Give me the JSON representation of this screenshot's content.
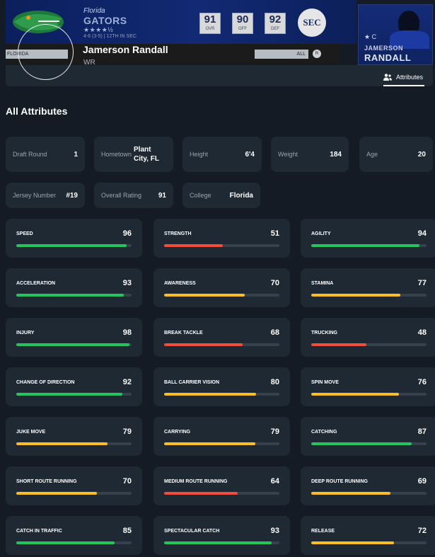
{
  "banner": {
    "school": "Florida",
    "team": "GATORS",
    "stars": "★★★★½",
    "record": "4-6 (3-5) | 12TH IN SEC",
    "ratings": [
      {
        "value": "91",
        "label": "OVR"
      },
      {
        "value": "90",
        "label": "OFF"
      },
      {
        "value": "92",
        "label": "DEF"
      }
    ],
    "conference": "SEC"
  },
  "subbar": {
    "school_tag": "FLORIDA",
    "filter": "ALL"
  },
  "player": {
    "name": "Jamerson Randall",
    "position": "WR",
    "card_first": "JAMERSON",
    "card_last": "RANDALL",
    "card_icons": "★ C"
  },
  "tabs": {
    "attributes": "Attributes"
  },
  "section_title": "All Attributes",
  "info": {
    "draft_round": {
      "label": "Draft Round",
      "value": "1"
    },
    "hometown": {
      "label": "Hometown",
      "value": "Plant City, FL"
    },
    "height": {
      "label": "Height",
      "value": "6'4"
    },
    "weight": {
      "label": "Weight",
      "value": "184"
    },
    "age": {
      "label": "Age",
      "value": "20"
    },
    "jersey": {
      "label": "Jersey Number",
      "value": "#19"
    },
    "overall": {
      "label": "Overall Rating",
      "value": "91"
    },
    "college": {
      "label": "College",
      "value": "Florida"
    }
  },
  "colors": {
    "high": "#22c55e",
    "mid": "#fbbf24",
    "low": "#f04e3a",
    "track": "#37414d",
    "card": "#1f2933",
    "background": "#141b24"
  },
  "attributes": [
    {
      "name": "SPEED",
      "value": 96
    },
    {
      "name": "STRENGTH",
      "value": 51
    },
    {
      "name": "AGILITY",
      "value": 94
    },
    {
      "name": "ACCELERATION",
      "value": 93
    },
    {
      "name": "AWARENESS",
      "value": 70
    },
    {
      "name": "STAMINA",
      "value": 77
    },
    {
      "name": "INJURY",
      "value": 98
    },
    {
      "name": "BREAK TACKLE",
      "value": 68
    },
    {
      "name": "TRUCKING",
      "value": 48
    },
    {
      "name": "CHANGE OF DIRECTION",
      "value": 92
    },
    {
      "name": "BALL CARRIER VISION",
      "value": 80
    },
    {
      "name": "SPIN MOVE",
      "value": 76
    },
    {
      "name": "JUKE MOVE",
      "value": 79
    },
    {
      "name": "CARRYING",
      "value": 79
    },
    {
      "name": "CATCHING",
      "value": 87
    },
    {
      "name": "SHORT ROUTE RUNNING",
      "value": 70
    },
    {
      "name": "MEDIUM ROUTE RUNNING",
      "value": 64
    },
    {
      "name": "DEEP ROUTE RUNNING",
      "value": 69
    },
    {
      "name": "CATCH IN TRAFFIC",
      "value": 85
    },
    {
      "name": "SPECTACULAR CATCH",
      "value": 93
    },
    {
      "name": "RELEASE",
      "value": 72
    }
  ]
}
